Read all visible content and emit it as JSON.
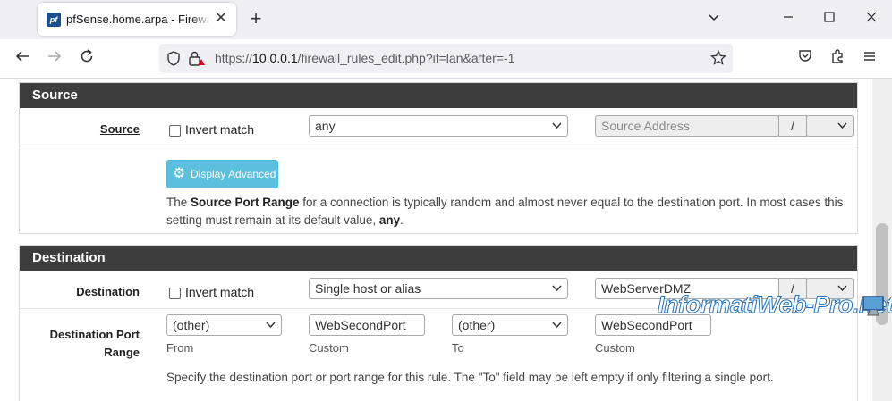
{
  "browser": {
    "tab_title": "pfSense.home.arpa - Firewall: R",
    "favicon_text": "pf",
    "new_tab": "+",
    "url_prefix": "https://",
    "url_host": "10.0.0.1",
    "url_path": "/firewall_rules_edit.php?if=lan&after=-1"
  },
  "source": {
    "heading": "Source",
    "label": "Source",
    "invert_label": "Invert match",
    "type_value": "any",
    "address_placeholder": "Source Address",
    "slash": "/",
    "display_advanced": "Display Advanced",
    "help_prefix": "The ",
    "help_bold1": "Source Port Range",
    "help_mid": " for a connection is typically random and almost never equal to the destination port. In most cases this setting must remain at its default value, ",
    "help_bold2": "any",
    "help_end": "."
  },
  "destination": {
    "heading": "Destination",
    "label": "Destination",
    "invert_label": "Invert match",
    "type_value": "Single host or alias",
    "address_value": "WebServerDMZ",
    "slash": "/",
    "port_range_label_1": "Destination Port",
    "port_range_label_2": "Range",
    "from_select": "(other)",
    "from_custom": "WebSecondPort",
    "to_select": "(other)",
    "to_custom": "WebSecondPort",
    "from_help": "From",
    "from_custom_help": "Custom",
    "to_help": "To",
    "to_custom_help": "Custom",
    "port_help": "Specify the destination port or port range for this rule. The \"To\" field may be left empty if only filtering a single port."
  },
  "watermark": "InformatiWeb-Pro.net",
  "colors": {
    "panel_heading": "#3d3d3d",
    "info_button": "#5bc0de"
  }
}
